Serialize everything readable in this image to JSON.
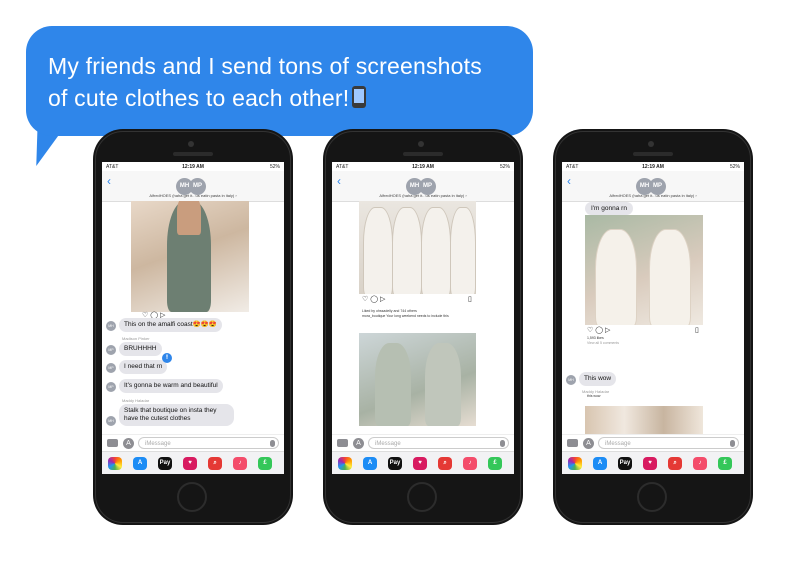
{
  "callout": {
    "line1": "My friends and I send tons of screenshots",
    "line2": "of cute clothes to each other!",
    "emoji": "mobile-phone-icon"
  },
  "status": {
    "carrier": "AT&T",
    "time": "12:19 AM",
    "battery": "52%"
  },
  "conversation": {
    "avatar_1": "MH",
    "avatar_2": "MP",
    "group_name": "AlfredHOES (haha get it.. us eatin pasta in italy) ›",
    "input_placeholder": "iMessage"
  },
  "phone1": {
    "messages": [
      {
        "avatar": "MH",
        "text": "This on the amalfi coast😍😍😍"
      },
      {
        "sender": "Madison Pinker",
        "avatar": "MP",
        "text": "BRUHHHH"
      },
      {
        "avatar": "MP",
        "text": "I need that rn",
        "tapback": "‼"
      },
      {
        "avatar": "MP",
        "text": "It's gonna be warm and beautiful"
      },
      {
        "sender": "Maddy Haladar",
        "avatar": "MH",
        "text": "Stalk that boutique on insta they have the cutest clothes"
      }
    ]
  },
  "phone2": {
    "liked_by": "Liked by ohssadelly and 744 others",
    "caption": "mora_boutique  Your long weekend needs to include this",
    "post_user": "mora_boutique"
  },
  "phone3": {
    "messages": [
      {
        "text": "I'm gonna rn"
      },
      {
        "avatar": "MH",
        "text": "This wow"
      },
      {
        "sender": "Maddy Haladar",
        "text": "this wow"
      }
    ],
    "likes": "1,593 likes",
    "comments": "View all 5 comments"
  },
  "dock_apps": [
    {
      "icon": "photos-icon",
      "label": "",
      "color": "#ffffff"
    },
    {
      "icon": "app-store-icon",
      "label": "A",
      "color": "#1c8cf5"
    },
    {
      "icon": "apple-pay-icon",
      "label": "Pay",
      "color": "#111111"
    },
    {
      "icon": "heart-sticker-icon",
      "label": "♥",
      "color": "#d81b60"
    },
    {
      "icon": "images-search-icon",
      "label": "⌕",
      "color": "#e53935"
    },
    {
      "icon": "music-icon",
      "label": "♪",
      "color": "#f44d6b"
    },
    {
      "icon": "money-icon",
      "label": "£",
      "color": "#34c759"
    }
  ]
}
